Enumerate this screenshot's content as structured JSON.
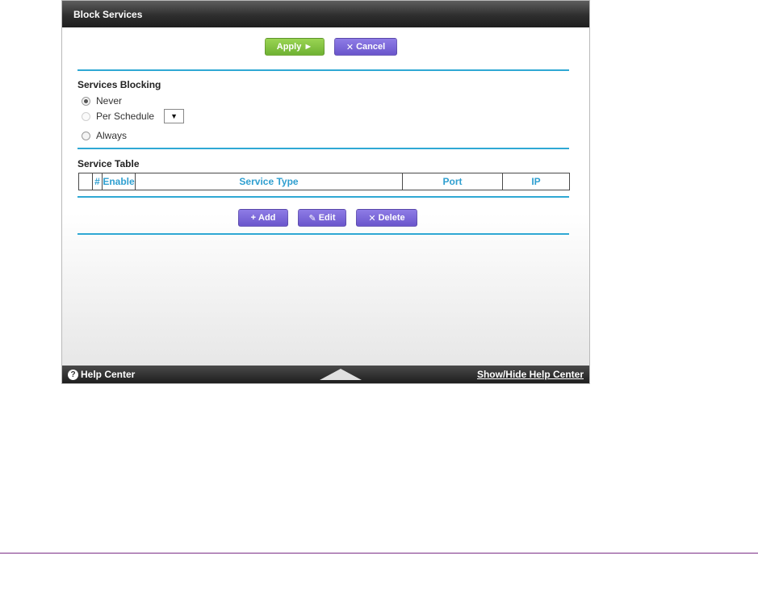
{
  "panel": {
    "title": "Block Services"
  },
  "actions": {
    "apply_label": "Apply",
    "apply_glyph": "►",
    "cancel_label": "Cancel",
    "cancel_glyph": "✕"
  },
  "blocking": {
    "heading": "Services Blocking",
    "options": [
      {
        "label": "Never",
        "selected": true
      },
      {
        "label": "Per Schedule",
        "selected": false
      },
      {
        "label": "Always",
        "selected": false
      }
    ],
    "schedule_select_glyph": "▼"
  },
  "service_table": {
    "heading": "Service Table",
    "columns": [
      "",
      "#",
      "Enable",
      "Service Type",
      "Port",
      "IP"
    ],
    "rows": []
  },
  "table_actions": {
    "add_label": "Add",
    "add_glyph": "+",
    "edit_label": "Edit",
    "edit_glyph": "✎",
    "delete_label": "Delete",
    "delete_glyph": "✕"
  },
  "footer": {
    "help_icon_glyph": "?",
    "help_center_label": "Help Center",
    "toggle_label": "Show/Hide Help Center"
  },
  "colors": {
    "accent_blue": "#2fa8d4",
    "apply_green": "#7cc03b",
    "button_purple": "#7b68dd",
    "bottom_rule_purple": "#7b2f86"
  }
}
